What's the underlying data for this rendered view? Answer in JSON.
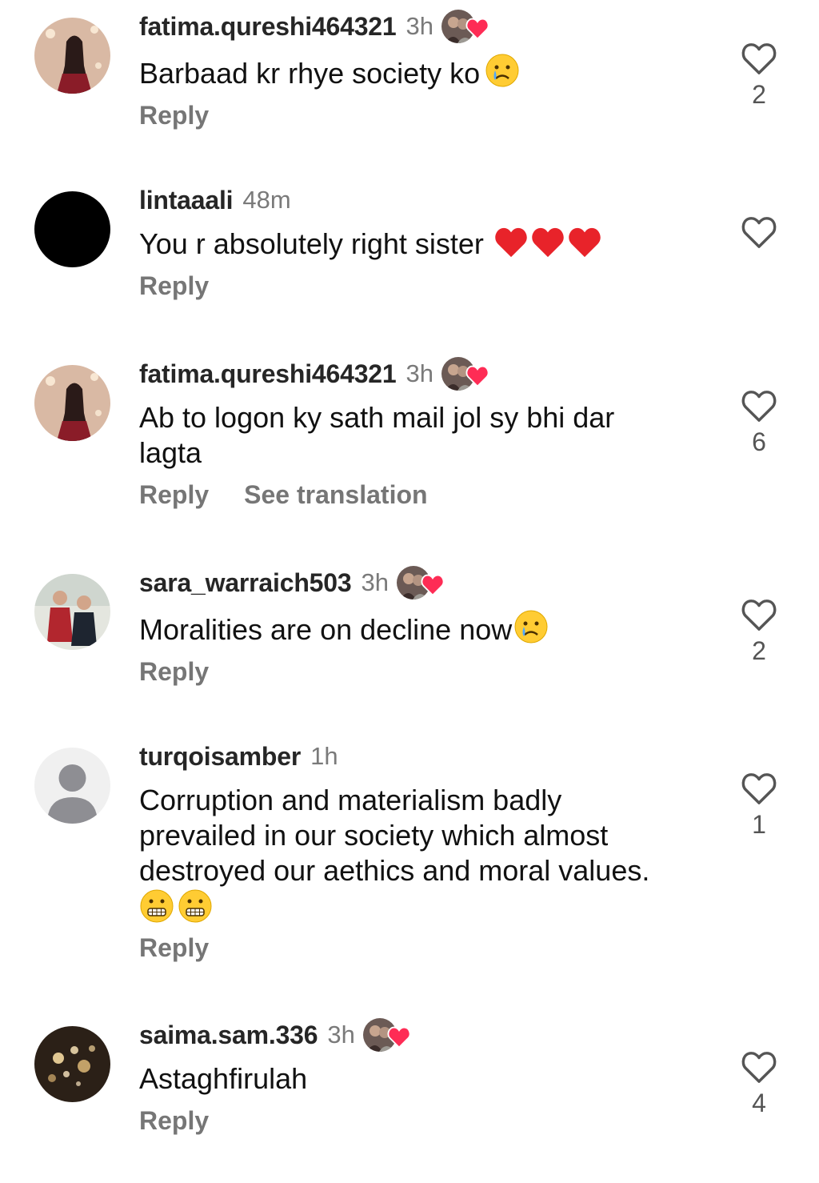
{
  "comments": [
    {
      "username": "fatima.qureshi464321",
      "time": "3h",
      "text": "Barbaad kr rhye society ko",
      "reply_label": "Reply",
      "likes": "2",
      "avatar": "portrait-photo",
      "liked_by_creator": true,
      "emojis": [
        "crying-face"
      ]
    },
    {
      "username": "lintaaali",
      "time": "48m",
      "text": "You r absolutely right sister",
      "reply_label": "Reply",
      "likes": "",
      "avatar": "black-circle",
      "liked_by_creator": false,
      "emojis": [
        "red-heart",
        "red-heart",
        "red-heart"
      ]
    },
    {
      "username": "fatima.qureshi464321",
      "time": "3h",
      "text": "Ab to logon ky sath mail jol sy bhi dar\nlagta",
      "reply_label": "Reply",
      "translation_label": "See translation",
      "likes": "6",
      "avatar": "portrait-photo",
      "liked_by_creator": true,
      "emojis": []
    },
    {
      "username": "sara_warraich503",
      "time": "3h",
      "text": "Moralities are on decline now",
      "reply_label": "Reply",
      "likes": "2",
      "avatar": "children-photo",
      "liked_by_creator": true,
      "emojis": [
        "crying-face"
      ]
    },
    {
      "username": "turqoisamber",
      "time": "1h",
      "text": "Corruption and materialism badly\nprevailed in our society which almost\ndestroyed our aethics and moral values.",
      "reply_label": "Reply",
      "likes": "1",
      "avatar": "default-person",
      "liked_by_creator": false,
      "emojis": [
        "grimacing-face",
        "grimacing-face"
      ]
    },
    {
      "username": "saima.sam.336",
      "time": "3h",
      "text": "Astaghfirulah",
      "reply_label": "Reply",
      "likes": "4",
      "avatar": "bokeh-photo",
      "liked_by_creator": true,
      "emojis": []
    }
  ],
  "colors": {
    "username": "#262626",
    "meta_gray": "#767676",
    "heart_red": "#fe2c55"
  }
}
